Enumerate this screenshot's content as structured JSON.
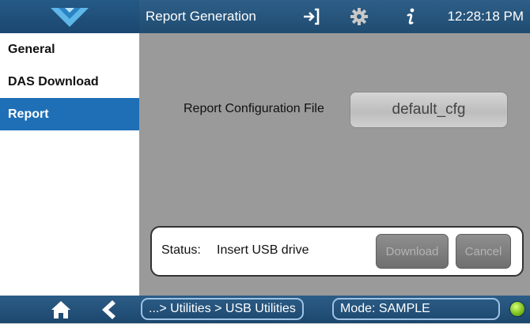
{
  "header": {
    "title": "Report Generation",
    "time": "12:28:18 PM",
    "icons": [
      "logo-icon",
      "login-icon",
      "gear-icon",
      "info-icon"
    ]
  },
  "sidebar": {
    "items": [
      {
        "label": "General",
        "active": false
      },
      {
        "label": "DAS Download",
        "active": false
      },
      {
        "label": "Report",
        "active": true
      }
    ]
  },
  "main": {
    "config_label": "Report Configuration File",
    "config_value": "default_cfg",
    "status_label": "Status:",
    "status_value": "Insert USB drive",
    "download_label": "Download",
    "cancel_label": "Cancel"
  },
  "footer": {
    "breadcrumb": "...> Utilities > USB Utilities",
    "mode": "Mode: SAMPLE",
    "led_color": "#7ec11f"
  },
  "colors": {
    "header": "#1f4b70",
    "active": "#1f6fb6",
    "content_bg": "#9a9a9a"
  }
}
